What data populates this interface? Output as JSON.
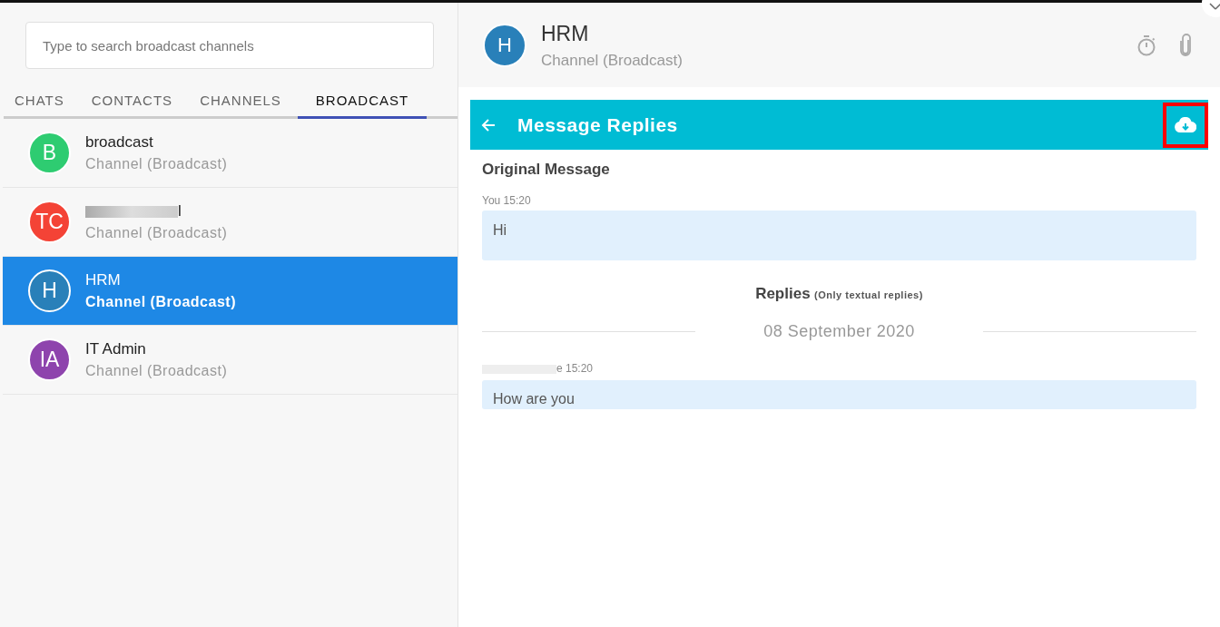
{
  "search": {
    "placeholder": "Type to search broadcast channels"
  },
  "tabs": [
    {
      "label": "CHATS",
      "selected": false
    },
    {
      "label": "CONTACTS",
      "selected": false
    },
    {
      "label": "CHANNELS",
      "selected": false
    },
    {
      "label": "BROADCAST",
      "selected": true
    }
  ],
  "channels": [
    {
      "initials": "B",
      "name": "broadcast",
      "redacted": false,
      "subtitle": "Channel (Broadcast)",
      "color": "#2ecc71",
      "selected": false
    },
    {
      "initials": "TC",
      "name": "l",
      "redacted": true,
      "subtitle": "Channel (Broadcast)",
      "color": "#f44336",
      "selected": false
    },
    {
      "initials": "H",
      "name": "HRM",
      "redacted": false,
      "subtitle": "Channel (Broadcast)",
      "color": "#2980b9",
      "selected": true
    },
    {
      "initials": "IA",
      "name": "IT Admin",
      "redacted": false,
      "subtitle": "Channel (Broadcast)",
      "color": "#8e44ad",
      "selected": false
    }
  ],
  "header": {
    "initials": "H",
    "color": "#2980b9",
    "title": "HRM",
    "subtitle": "Channel (Broadcast)"
  },
  "replies_panel": {
    "title": "Message Replies",
    "download_highlighted": true,
    "original_heading": "Original Message",
    "original_meta": "You 15:20",
    "original_text": "Hi",
    "replies_heading": "Replies",
    "replies_note": "(Only textual replies)",
    "date": "08 September 2020",
    "replies": [
      {
        "meta": "e 15:20",
        "redacted": true,
        "text": "How are you"
      }
    ]
  }
}
